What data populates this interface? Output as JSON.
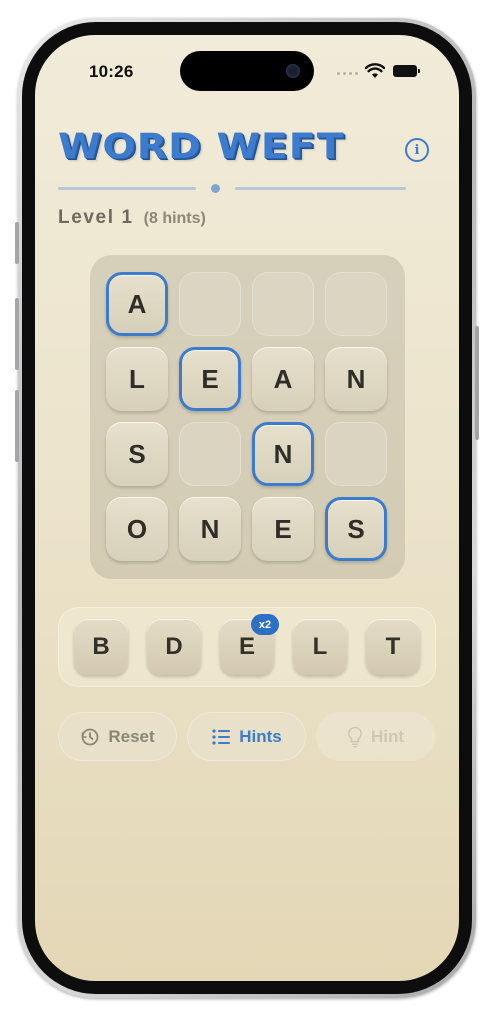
{
  "status_bar": {
    "time": "10:26",
    "signal_icon": "cellular-signal-icon",
    "wifi_icon": "wifi-icon",
    "battery_icon": "battery-icon"
  },
  "header": {
    "title": "WORD WEFT",
    "info_icon": "info-circle-icon",
    "info_glyph": "i"
  },
  "level": {
    "label": "Level 1",
    "hints": "(8 hints)"
  },
  "board": {
    "rows": [
      [
        {
          "letter": "A",
          "highlighted": true
        },
        {
          "letter": "",
          "highlighted": false
        },
        {
          "letter": "",
          "highlighted": false
        },
        {
          "letter": "",
          "highlighted": false
        }
      ],
      [
        {
          "letter": "L",
          "highlighted": false
        },
        {
          "letter": "E",
          "highlighted": true
        },
        {
          "letter": "A",
          "highlighted": false
        },
        {
          "letter": "N",
          "highlighted": false
        }
      ],
      [
        {
          "letter": "S",
          "highlighted": false
        },
        {
          "letter": "",
          "highlighted": false
        },
        {
          "letter": "N",
          "highlighted": true
        },
        {
          "letter": "",
          "highlighted": false
        }
      ],
      [
        {
          "letter": "O",
          "highlighted": false
        },
        {
          "letter": "N",
          "highlighted": false
        },
        {
          "letter": "E",
          "highlighted": false
        },
        {
          "letter": "S",
          "highlighted": true
        }
      ]
    ]
  },
  "tray": {
    "tiles": [
      "B",
      "D",
      "E",
      "L",
      "T"
    ],
    "badge": "x2"
  },
  "actions": {
    "reset": {
      "label": "Reset",
      "icon": "reset-icon"
    },
    "hints": {
      "label": "Hints",
      "icon": "list-icon"
    },
    "hint": {
      "label": "Hint",
      "icon": "lightbulb-icon"
    }
  },
  "colors": {
    "accent": "#3d7ccd",
    "badge": "#2e6fc6",
    "background_top": "#f1ebd9",
    "background_bottom": "#e3d7b6",
    "text": "#2f2d27"
  }
}
